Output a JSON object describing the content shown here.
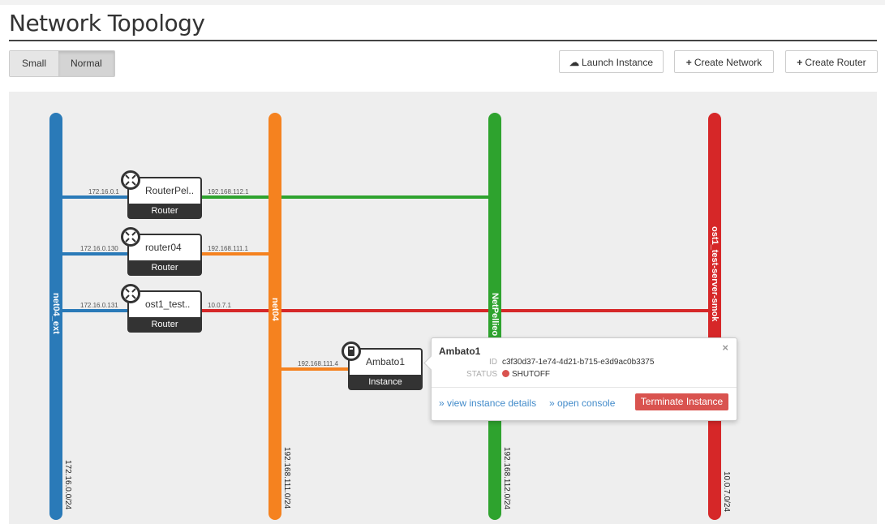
{
  "page": {
    "title": "Network Topology"
  },
  "toolbar": {
    "size_options": [
      "Small",
      "Normal"
    ],
    "selected_size": "Normal",
    "launch_instance": "Launch Instance",
    "create_network": "Create Network",
    "create_router": "Create Router"
  },
  "networks": [
    {
      "name": "net04_ext",
      "cidr": "172.16.0.0/24",
      "color": "#2a7ab8"
    },
    {
      "name": "net04",
      "cidr": "192.168.111.0/24",
      "color": "#f5821f"
    },
    {
      "name": "NetPellieo",
      "cidr": "192.168.112.0/24",
      "color": "#2ea32e"
    },
    {
      "name": "ost1_test-server-smok",
      "cidr": "10.0.7.0/24",
      "color": "#d62728"
    }
  ],
  "routers": [
    {
      "name": "RouterPel..",
      "type": "Router",
      "ext_ip": "172.16.0.1",
      "int_ip": "192.168.112.1"
    },
    {
      "name": "router04",
      "type": "Router",
      "ext_ip": "172.16.0.130",
      "int_ip": "192.168.111.1"
    },
    {
      "name": "ost1_test..",
      "type": "Router",
      "ext_ip": "172.16.0.131",
      "int_ip": "10.0.7.1"
    }
  ],
  "instance": {
    "name": "Ambato1",
    "type": "Instance",
    "ip": "192.168.111.4"
  },
  "popup": {
    "name": "Ambato1",
    "id_label": "ID",
    "id_value": "c3f30d37-1e74-4d21-b715-e3d9ac0b3375",
    "status_label": "STATUS",
    "status_value": "SHUTOFF",
    "status_color": "#d9534f",
    "close": "×",
    "view_details": "» view instance details",
    "open_console": "» open console",
    "terminate": "Terminate Instance"
  }
}
